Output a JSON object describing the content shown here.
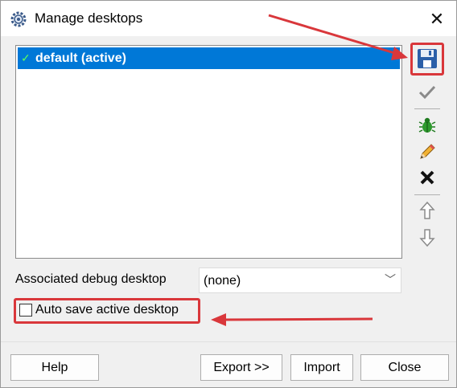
{
  "window": {
    "title": "Manage desktops"
  },
  "desktops": [
    {
      "label": "default (active)",
      "checked": true
    }
  ],
  "toolbar": [
    "save-icon",
    "check-icon",
    "bug-icon",
    "pencil-icon",
    "delete-icon",
    "arrow-up-icon",
    "arrow-down-icon"
  ],
  "debug": {
    "label": "Associated debug desktop",
    "value": "(none)"
  },
  "auto_save": {
    "label": "Auto save active desktop",
    "checked": false
  },
  "buttons": {
    "help": "Help",
    "export": "Export >>",
    "import": "Import",
    "close": "Close"
  },
  "colors": {
    "selection": "#0078d7",
    "annotation": "#d9373b"
  }
}
